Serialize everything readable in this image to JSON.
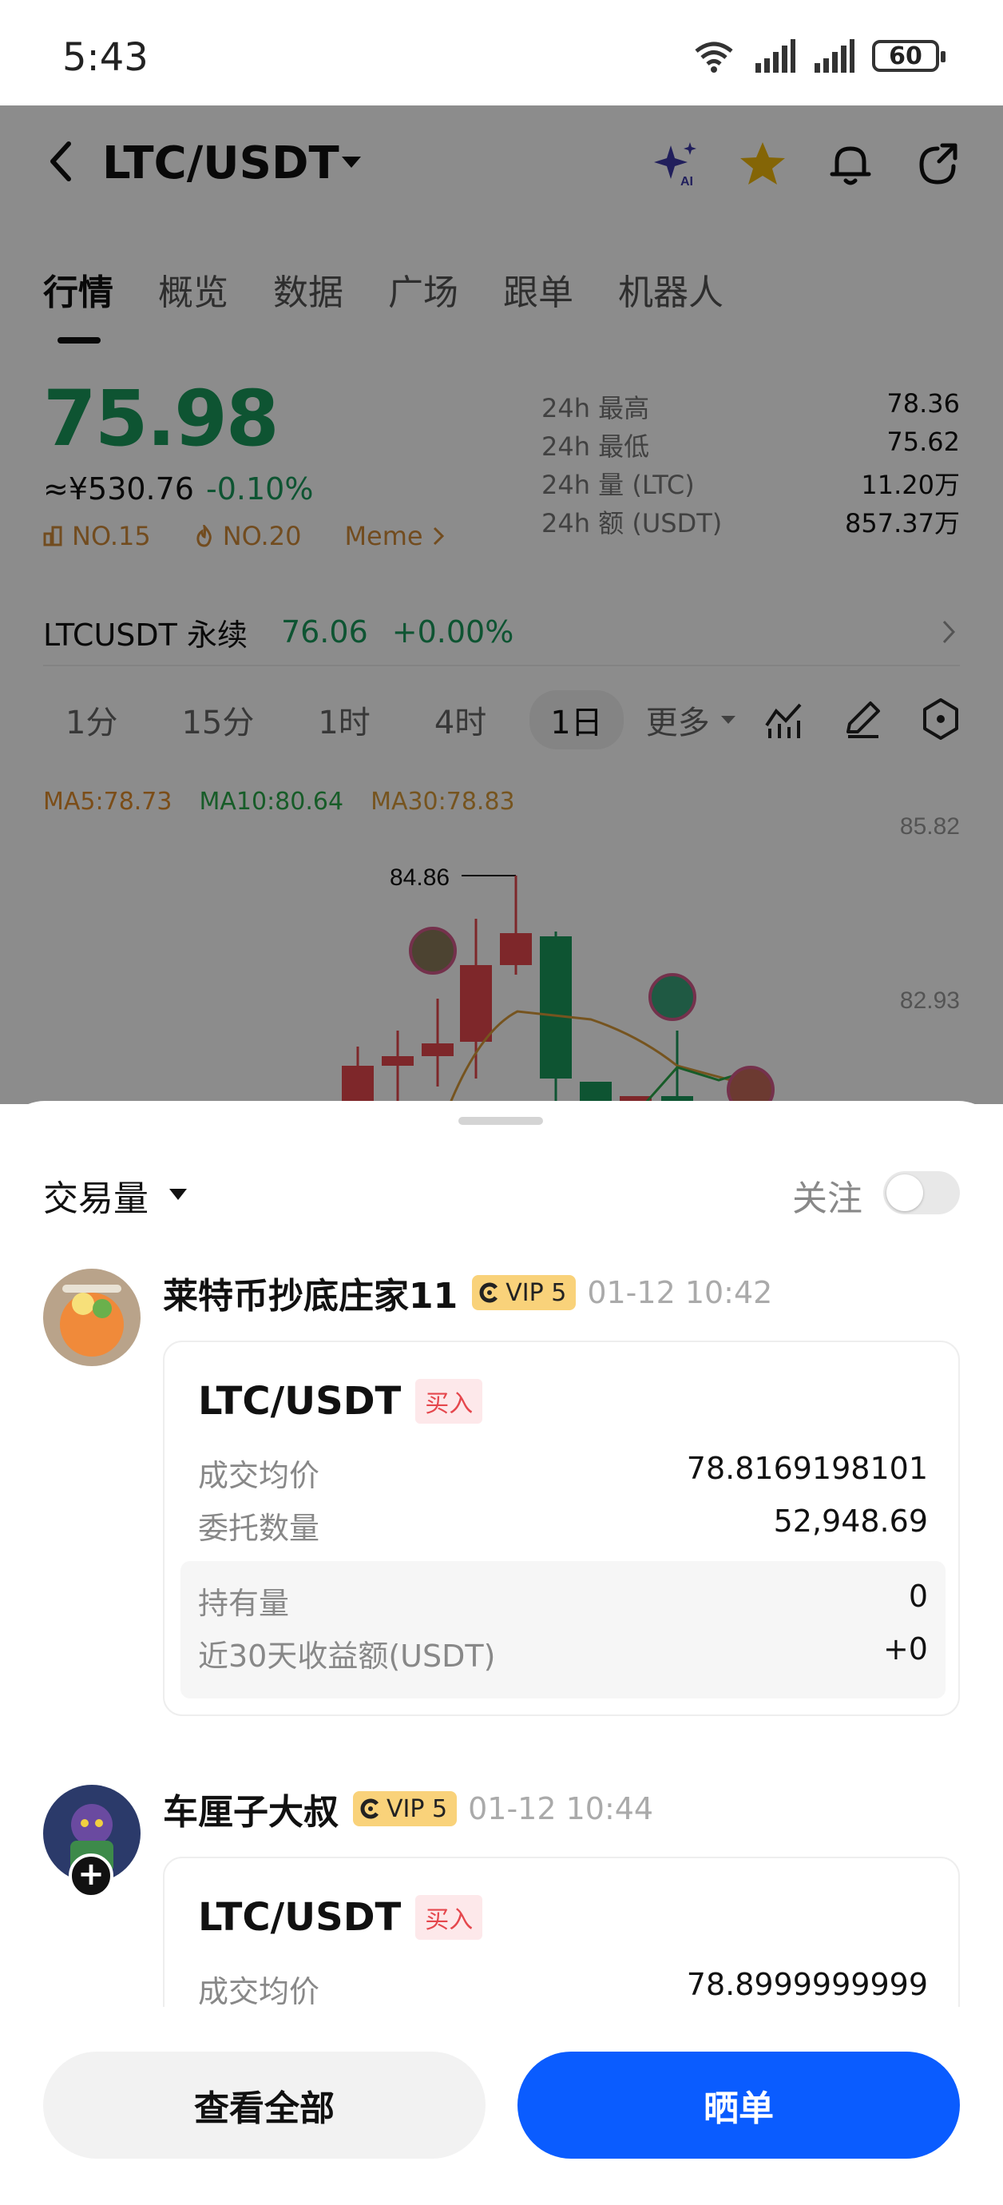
{
  "status_bar": {
    "time": "5:43",
    "battery": "60"
  },
  "nav": {
    "pair": "LTC/USDT"
  },
  "tabs": [
    "行情",
    "概览",
    "数据",
    "广场",
    "跟单",
    "机器人"
  ],
  "price": {
    "last": "75.98",
    "cny": "≈¥530.76",
    "change": "-0.10%",
    "rank1": "NO.15",
    "rank2": "NO.20",
    "category": "Meme"
  },
  "stats": [
    {
      "label": "24h  最高",
      "value": "78.36"
    },
    {
      "label": "24h  最低",
      "value": "75.62"
    },
    {
      "label": "24h  量 (LTC)",
      "value": "11.20万"
    },
    {
      "label": "24h  额 (USDT)",
      "value": "857.37万"
    }
  ],
  "perp": {
    "name": "LTCUSDT 永续",
    "price": "76.06",
    "change": "+0.00%"
  },
  "intervals": [
    "1分",
    "15分",
    "1时",
    "4时",
    "1日"
  ],
  "interval_selected": "1日",
  "interval_more": "更多",
  "chart": {
    "ma5": "MA5:78.73",
    "ma10": "MA10:80.64",
    "ma30": "MA30:78.83",
    "axis_top": "85.82",
    "axis_mid": "82.93",
    "high_label": "84.86"
  },
  "sheet": {
    "sort_label": "交易量",
    "follow_label": "关注",
    "follow_on": false
  },
  "posts": [
    {
      "username": "莱特币抄底庄家11",
      "vip": "VIP 5",
      "time": "01-12 10:42",
      "pair": "LTC/USDT",
      "side": "买入",
      "avg_price_label": "成交均价",
      "avg_price": "78.8169198101",
      "qty_label": "委托数量",
      "qty": "52,948.69",
      "hold_label": "持有量",
      "hold": "0",
      "pnl_label": "近30天收益额(USDT)",
      "pnl": "+0"
    },
    {
      "username": "车厘子大叔",
      "vip": "VIP 5",
      "time": "01-12 10:44",
      "pair": "LTC/USDT",
      "side": "买入",
      "avg_price_label": "成交均价",
      "avg_price": "78.8999999999"
    }
  ],
  "footer": {
    "view_all": "查看全部",
    "share": "晒单"
  },
  "colors": {
    "up": "#1a9a5c",
    "down": "#e5474d",
    "primary": "#0a5cff",
    "vip": "#f9d27a"
  }
}
